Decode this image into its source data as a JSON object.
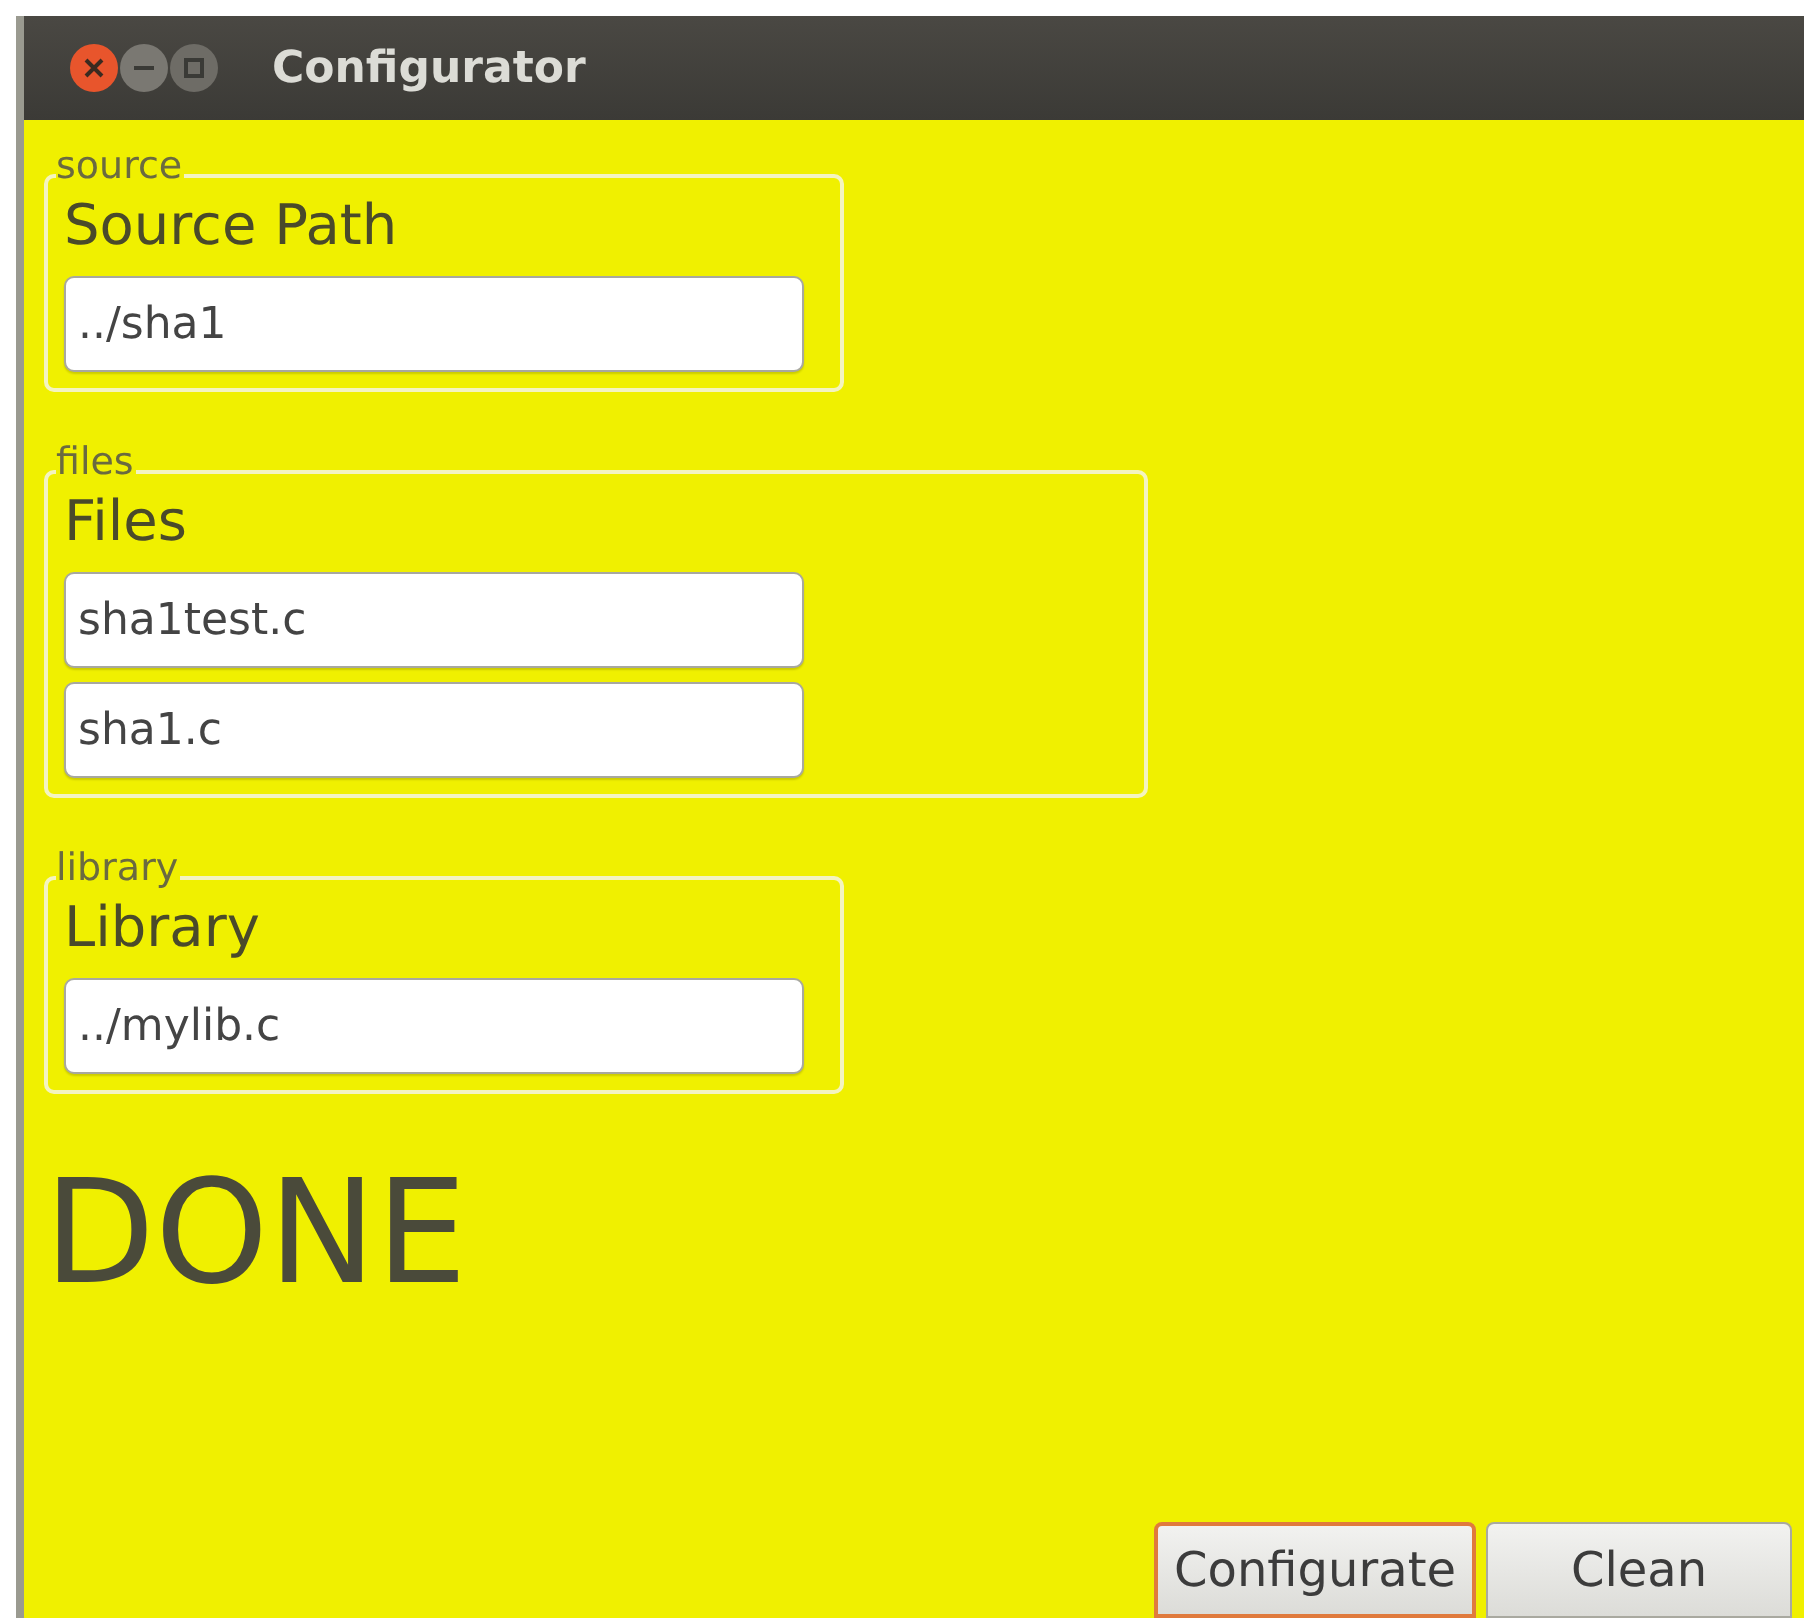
{
  "window": {
    "title": "Configurator"
  },
  "groups": [
    {
      "legend": "source",
      "label": "Source Path",
      "fields": [
        {
          "value": "../sha1"
        }
      ]
    },
    {
      "legend": "files",
      "label": "Files",
      "fields": [
        {
          "value": "sha1test.c"
        },
        {
          "value": "sha1.c"
        }
      ]
    },
    {
      "legend": "library",
      "label": "Library",
      "fields": [
        {
          "value": "../mylib.c"
        }
      ]
    }
  ],
  "status": "DONE",
  "buttons": [
    {
      "label": "Configurate",
      "focused": true
    },
    {
      "label": "Clean",
      "focused": false
    }
  ]
}
